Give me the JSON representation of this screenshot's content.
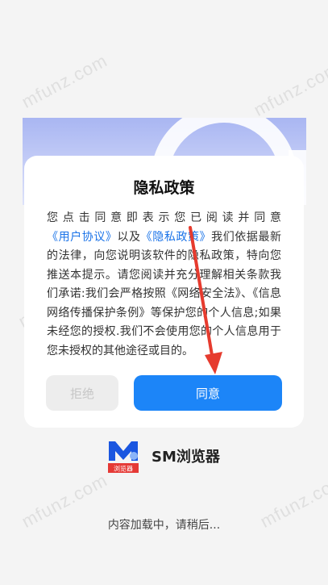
{
  "watermark_text": "mfunz.com",
  "dialog": {
    "title": "隐私政策",
    "body": {
      "t1": "您点击同意即表示您已阅读并同意",
      "link_user": "《用户协议》",
      "t2": "以及",
      "link_privacy": "《隐私政策》",
      "t3": "我们依据最新的法律，向您说明该软件的隐私政策，特向您推送本提示。请您阅读并充分理解相关条款我们承诺:我们会严格按照《网络安全法》、《信息网络传播保护条例》等保护您的个人信息;如果未经您的授权.我们不会使用您的个人信息用于您未授权的其他途径或目的。"
    },
    "decline_label": "拒绝",
    "agree_label": "同意"
  },
  "brand": {
    "name": "SM浏览器",
    "logo_caption": "浏览器"
  },
  "loading_text": "内容加载中，请稍后...",
  "colors": {
    "link": "#1a73e8",
    "agree_button": "#1c85f8",
    "arrow": "#e63b2e",
    "logo_blue": "#1a56e0",
    "logo_red": "#e53935"
  }
}
